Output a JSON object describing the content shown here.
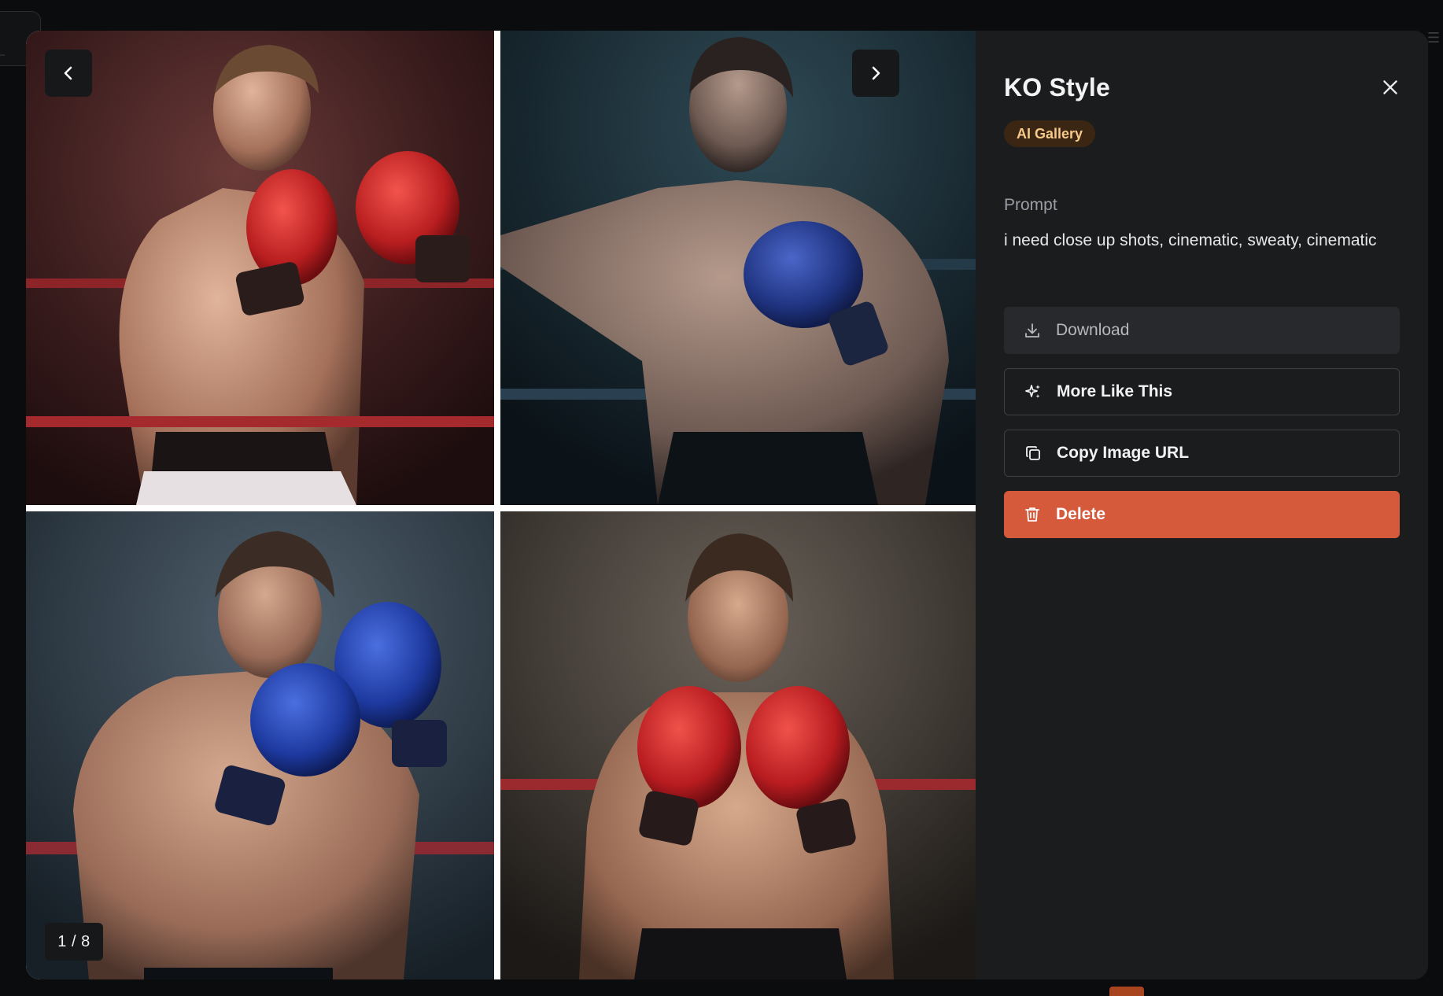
{
  "modal": {
    "title": "KO Style",
    "badge": "AI Gallery",
    "close_icon": "close-icon"
  },
  "gallery": {
    "counter": "1 / 8",
    "prev_icon": "chevron-left-icon",
    "next_icon": "chevron-right-icon",
    "images": [
      {
        "subject": "boxer with red gloves in front of red ropes"
      },
      {
        "subject": "boxer with blue glove leaning on dark ring ropes"
      },
      {
        "subject": "boxer with blue gloves in guard stance"
      },
      {
        "subject": "boxer with red gloves facing forward"
      }
    ]
  },
  "prompt": {
    "label": "Prompt",
    "text": "i need close up shots, cinematic, sweaty, cinematic"
  },
  "actions": {
    "download": {
      "label": "Download",
      "icon": "download-icon"
    },
    "more_like_this": {
      "label": "More Like This",
      "icon": "sparkles-icon"
    },
    "copy_url": {
      "label": "Copy Image URL",
      "icon": "copy-icon"
    },
    "delete": {
      "label": "Delete",
      "icon": "trash-icon"
    }
  },
  "colors": {
    "delete_bg": "#d55a3c",
    "badge_bg": "#3a2612",
    "badge_text": "#f6c98b",
    "panel_bg": "#1b1c1e"
  }
}
